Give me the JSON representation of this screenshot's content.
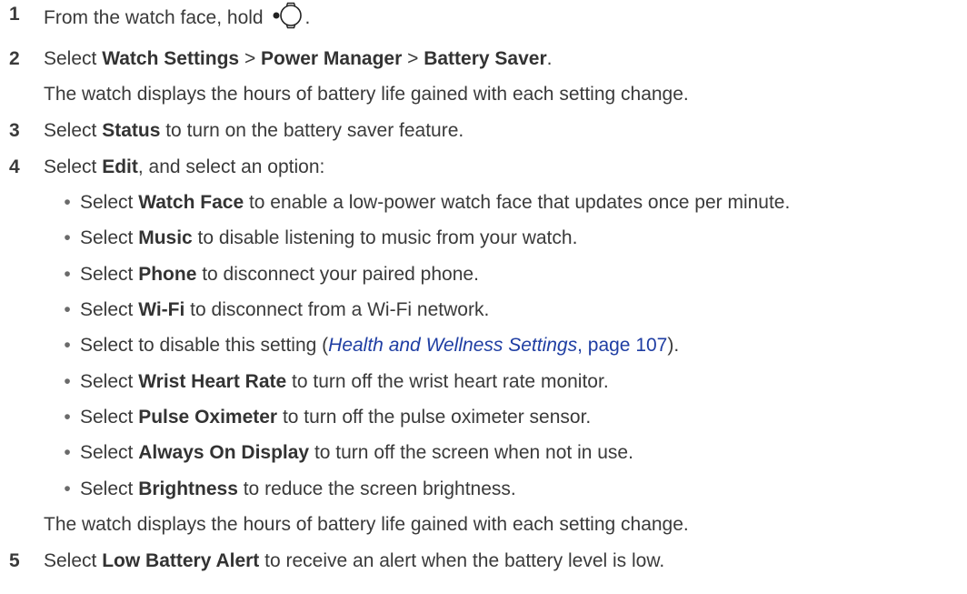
{
  "steps": [
    {
      "number": "1",
      "pre": "From the watch face, hold ",
      "post": "."
    },
    {
      "number": "2",
      "pre": "Select ",
      "b1": "Watch Settings",
      "sep1": " > ",
      "b2": "Power Manager",
      "sep2": " > ",
      "b3": "Battery Saver",
      "post": "."
    },
    {
      "note": "The watch displays the hours of battery life gained with each setting change."
    },
    {
      "number": "3",
      "pre": "Select ",
      "b1": "Status",
      "post": " to turn on the battery saver feature."
    },
    {
      "number": "4",
      "pre": "Select ",
      "b1": "Edit",
      "post": ", and select an option:"
    },
    {
      "number": "5",
      "pre": "Select ",
      "b1": "Low Battery Alert",
      "post": " to receive an alert when the battery level is low."
    }
  ],
  "options": [
    {
      "pre": "Select ",
      "bold": "Watch Face",
      "post": " to enable a low-power watch face that updates once per minute."
    },
    {
      "pre": "Select ",
      "bold": "Music",
      "post": " to disable listening to music from your watch."
    },
    {
      "pre": "Select ",
      "bold": "Phone",
      "post": " to disconnect your paired phone."
    },
    {
      "pre": "Select ",
      "bold": "Wi-Fi",
      "post": " to disconnect from a Wi-Fi network."
    },
    {
      "pre": "Select to disable this setting (",
      "link_italic": "Health and Wellness Settings",
      "link_rest": ", page 107",
      "post": ")."
    },
    {
      "pre": "Select ",
      "bold": "Wrist Heart Rate",
      "post": " to turn off the wrist heart rate monitor."
    },
    {
      "pre": "Select ",
      "bold": "Pulse Oximeter",
      "post": " to turn off the pulse oximeter sensor."
    },
    {
      "pre": "Select ",
      "bold": "Always On Display",
      "post": " to turn off the screen when not in use."
    },
    {
      "pre": "Select ",
      "bold": "Brightness",
      "post": " to reduce the screen brightness."
    }
  ],
  "note_after_options": "The watch displays the hours of battery life gained with each setting change.",
  "bullet_char": "•",
  "icons": {
    "hold_button": "watch-button-icon"
  },
  "colors": {
    "text": "#3a3a3a",
    "link": "#1f3ea3"
  }
}
